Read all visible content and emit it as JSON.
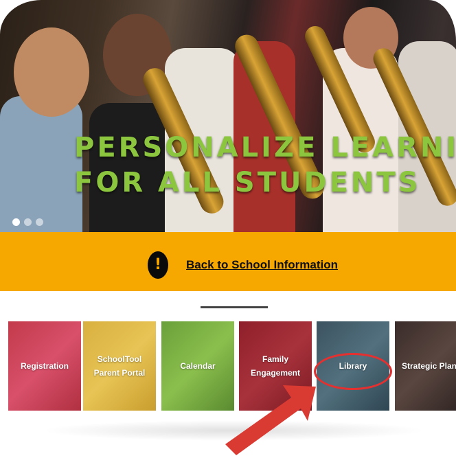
{
  "hero": {
    "title_line1": "PERSONALIZE LEARNING",
    "title_line2": "FOR ALL STUDENTS",
    "slides": 3,
    "active_slide": 1
  },
  "alert": {
    "icon": "exclamation-icon",
    "link_text": "Back to School Information"
  },
  "tiles": [
    {
      "label": "Registration",
      "color": "#c23a4a"
    },
    {
      "label_line1": "SchoolTool",
      "label_line2": "Parent Portal",
      "color": "#d8b040"
    },
    {
      "label": "Calendar",
      "color": "#6aa03a"
    },
    {
      "label_line1": "Family",
      "label_line2": "Engagement",
      "color": "#8e1f2a"
    },
    {
      "label": "Library",
      "color": "#3c5360"
    },
    {
      "label": "Strategic Plan",
      "color": "#3a2c2a"
    }
  ],
  "highlight_color": "#e53030"
}
